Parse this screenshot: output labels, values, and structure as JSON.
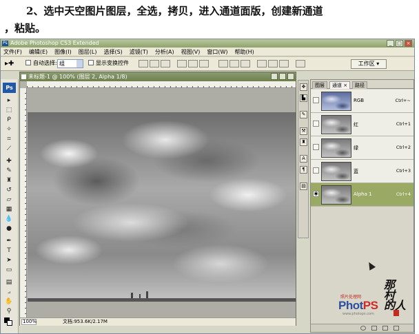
{
  "instruction": {
    "line1": "2、选中天空图片图层，全选，拷贝，进入通道面版，创建新通道",
    "line2": "，粘贴。"
  },
  "app": {
    "title": "Adobe Photoshop CS3 Extended",
    "menu": [
      "文件(F)",
      "编辑(E)",
      "图像(I)",
      "图层(L)",
      "选择(S)",
      "滤镜(T)",
      "分析(A)",
      "视图(V)",
      "窗口(W)",
      "帮助(H)"
    ]
  },
  "options": {
    "auto_select_label": "自动选择:",
    "auto_select_value": "组",
    "show_transform_label": "显示变换控件",
    "workspace_label": "工作区"
  },
  "toolbox": {
    "logo": "Ps"
  },
  "document": {
    "title": "未标题-1 @ 100% (图层 2, Alpha 1/8)",
    "zoom": "100%",
    "doc_info": "文档:953.6K/2.17M"
  },
  "channels_panel": {
    "tabs": [
      "图层",
      "通道 ×",
      "路径"
    ],
    "active_tab": 1,
    "channels": [
      {
        "name": "RGB",
        "shortcut": "Ctrl+~"
      },
      {
        "name": "红",
        "shortcut": "Ctrl+1"
      },
      {
        "name": "绿",
        "shortcut": "Ctrl+2"
      },
      {
        "name": "蓝",
        "shortcut": "Ctrl+3"
      },
      {
        "name": "Alpha 1",
        "shortcut": "Ctrl+4"
      }
    ],
    "selected_channel": "Alpha 1"
  },
  "watermark": {
    "tagline": "照片处理网",
    "brand_pre": "Phot",
    "brand_post": "PS",
    "url": "www.photops.com"
  }
}
